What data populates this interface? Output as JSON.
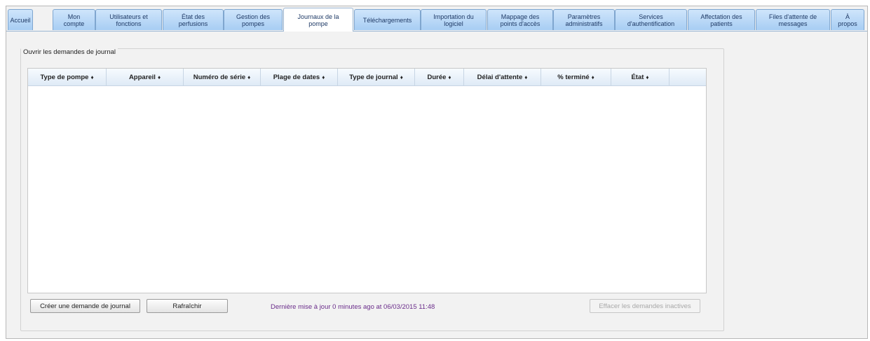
{
  "tabs": [
    {
      "label": "Accueil",
      "active": false
    },
    {
      "label": "Mon\ncompte",
      "active": false
    },
    {
      "label": "Utilisateurs et\nfonctions",
      "active": false
    },
    {
      "label": "État des\nperfusions",
      "active": false
    },
    {
      "label": "Gestion des\npompes",
      "active": false
    },
    {
      "label": "Journaux de la\npompe",
      "active": true
    },
    {
      "label": "Téléchargements",
      "active": false
    },
    {
      "label": "Importation du\nlogiciel",
      "active": false
    },
    {
      "label": "Mappage des\npoints d'accès",
      "active": false
    },
    {
      "label": "Paramètres\nadministratifs",
      "active": false
    },
    {
      "label": "Services\nd'authentification",
      "active": false
    },
    {
      "label": "Affectation des\npatients",
      "active": false
    },
    {
      "label": "Files d'attente de\nmessages",
      "active": false
    },
    {
      "label": "À\npropos",
      "active": false
    }
  ],
  "section": {
    "title": "Ouvrir les demandes de journal"
  },
  "table": {
    "sort_glyph": "♦",
    "columns": [
      {
        "label": "Type de pompe"
      },
      {
        "label": "Appareil"
      },
      {
        "label": "Numéro de série"
      },
      {
        "label": "Plage de dates"
      },
      {
        "label": "Type de journal"
      },
      {
        "label": "Durée"
      },
      {
        "label": "Délai d'attente"
      },
      {
        "label": "% terminé"
      },
      {
        "label": "État"
      }
    ],
    "rows": []
  },
  "buttons": {
    "create": "Créer une demande de journal",
    "refresh": "Rafraîchir",
    "clear_inactive": "Effacer les demandes inactives"
  },
  "status": {
    "last_update": "Dernière mise à jour 0 minutes ago at 06/03/2015 11:48"
  }
}
